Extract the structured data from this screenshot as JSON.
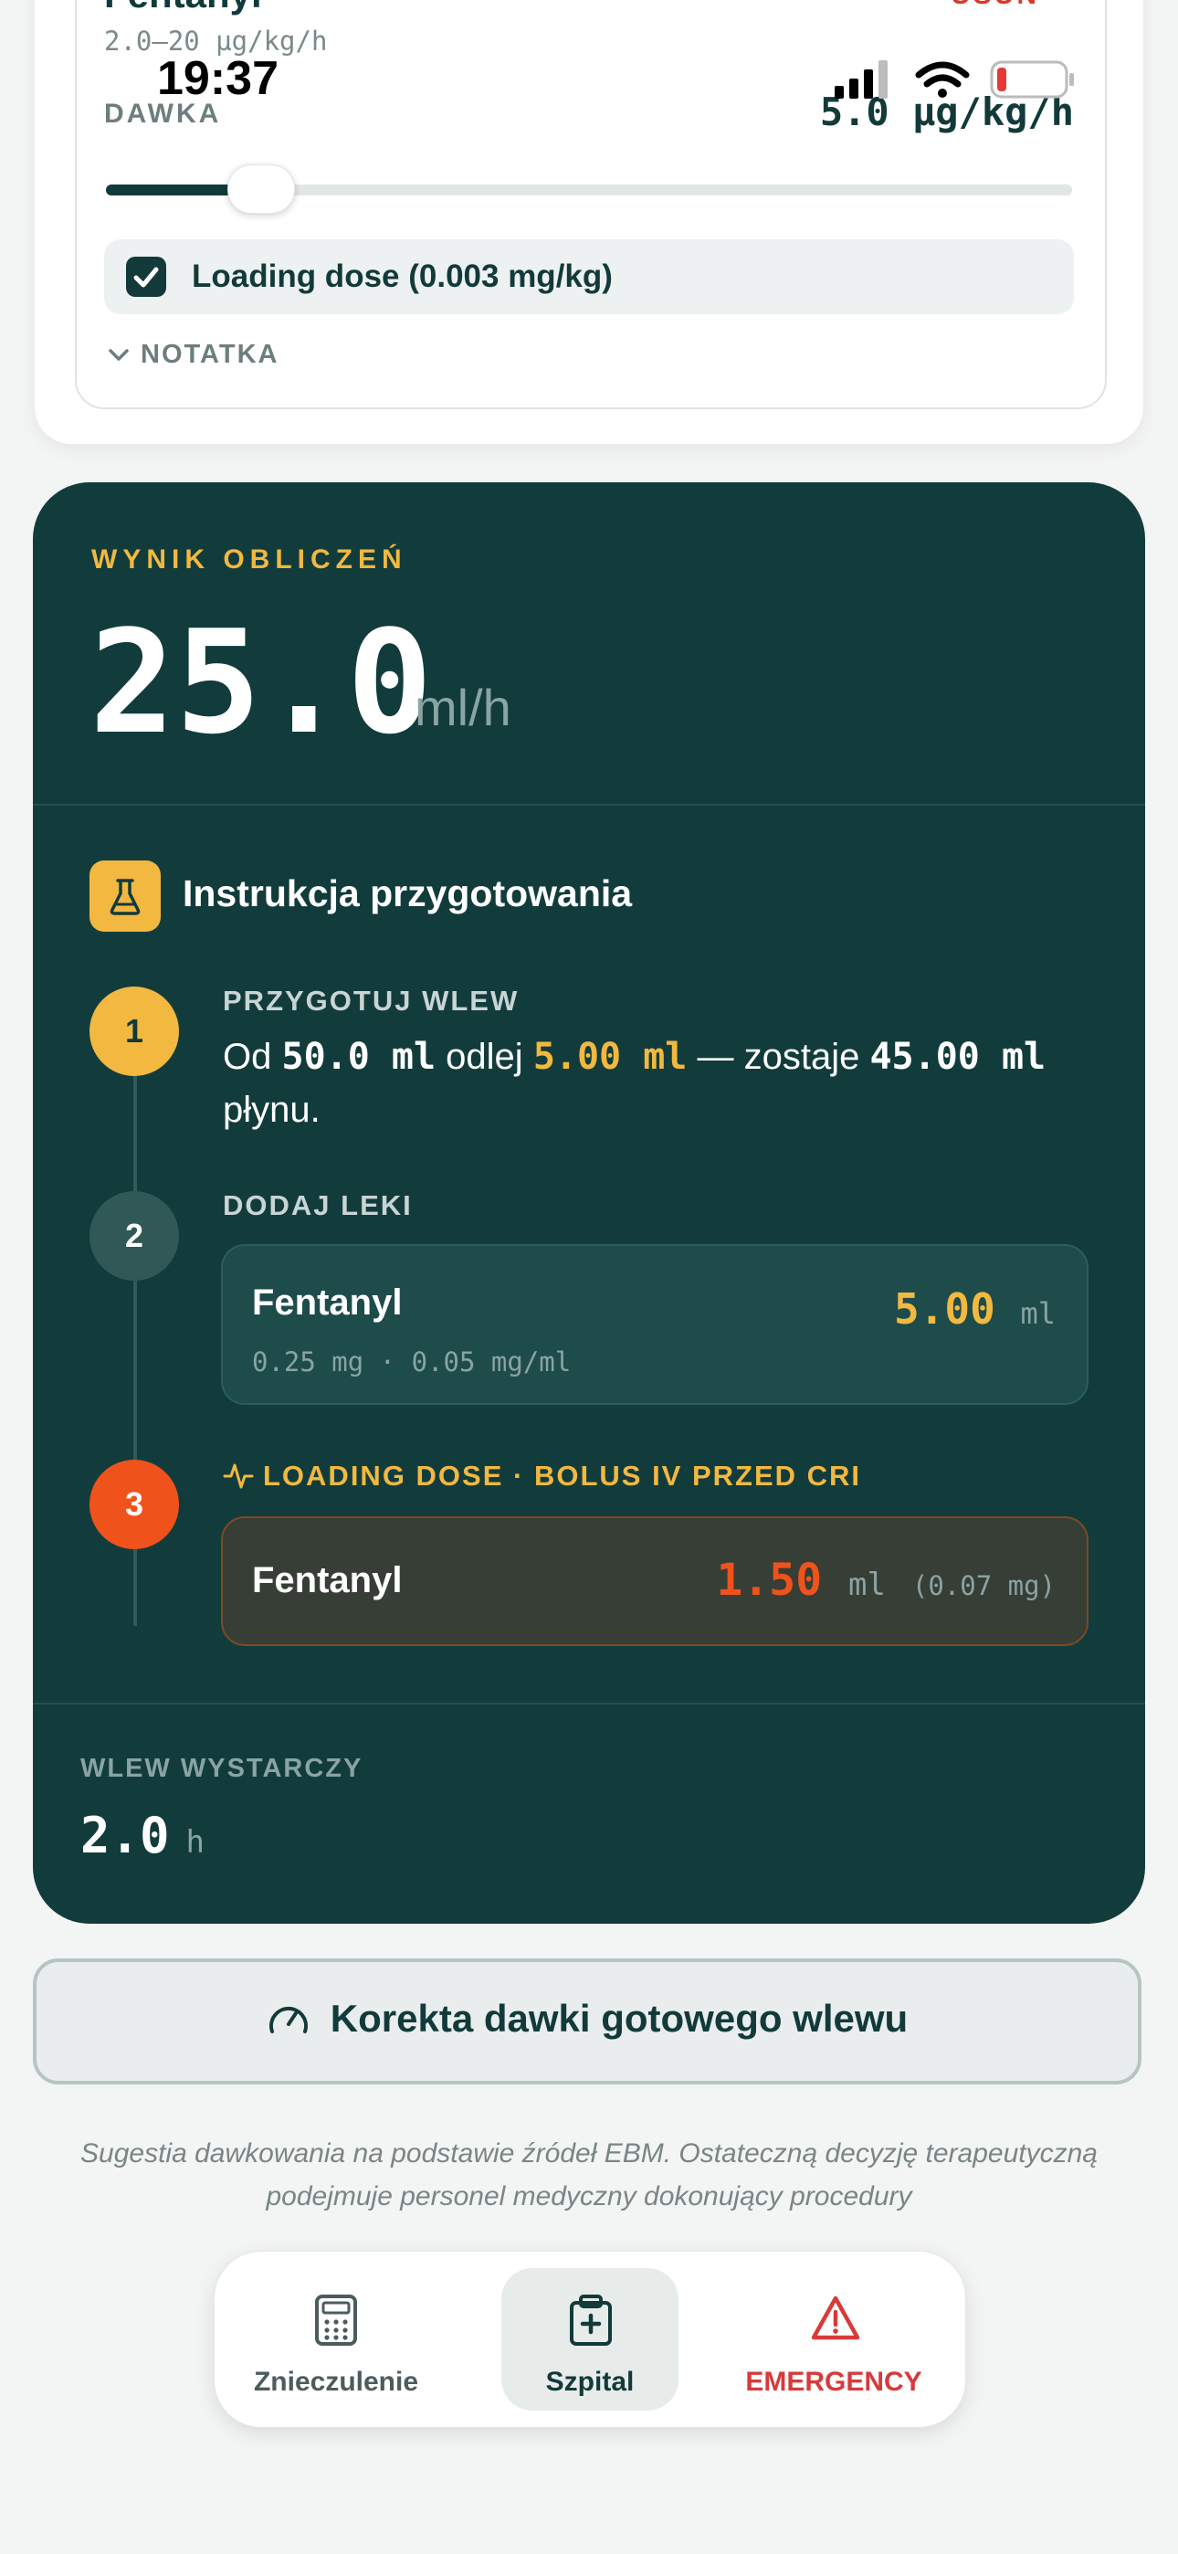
{
  "status_bar": {
    "time": "19:37"
  },
  "drug_card": {
    "name": "Fentanyl",
    "remove_label": "USUŃ",
    "range": "2.0–20 µg/kg/h",
    "dose_label": "DAWKA",
    "dose_value": "5.0 µg/kg/h",
    "dose_slider_fraction": 0.16,
    "loading_dose_checked": true,
    "loading_dose_label": "Loading dose (0.003 mg/kg)",
    "note_label": "NOTATKA"
  },
  "result": {
    "title": "WYNIK OBLICZEŃ",
    "value": "25.0",
    "unit": "ml/h",
    "instructions_title": "Instrukcja przygotowania",
    "step1": {
      "number": "1",
      "label": "PRZYGOTUJ WLEW",
      "t1": "Od ",
      "v1": "50.0 ml",
      "t2": " odlej ",
      "v2": "5.00 ml",
      "t3": " — zostaje ",
      "v3": "45.00 ml",
      "t4": " płynu."
    },
    "step2": {
      "number": "2",
      "label": "DODAJ LEKI",
      "drug_name": "Fentanyl",
      "drug_detail": "0.25 mg · 0.05 mg/ml",
      "volume": "5.00",
      "volume_unit": "ml"
    },
    "step3": {
      "number": "3",
      "label": "LOADING DOSE · BOLUS IV PRZED CRI",
      "drug_name": "Fentanyl",
      "volume": "1.50",
      "volume_unit": "ml",
      "dose": "(0.07 mg)"
    },
    "sufficient_label": "WLEW WYSTARCZY",
    "sufficient_value": "2.0",
    "sufficient_unit": "h"
  },
  "correction_button": "Korekta dawki gotowego wlewu",
  "disclaimer": "Sugestia dawkowania na podstawie źródeł EBM. Ostateczną decyzję terapeutyczną podejmuje personel medyczny dokonujący procedury",
  "nav": {
    "items": [
      {
        "label": "Znieczulenie",
        "icon": "calculator-icon"
      },
      {
        "label": "Szpital",
        "icon": "hospital-icon"
      },
      {
        "label": "EMERGENCY",
        "icon": "warning-icon"
      }
    ]
  },
  "colors": {
    "primary_dark": "#123c3c",
    "accent_yellow": "#f2b840",
    "accent_orange": "#f0521c",
    "danger_red": "#d83a2a"
  }
}
